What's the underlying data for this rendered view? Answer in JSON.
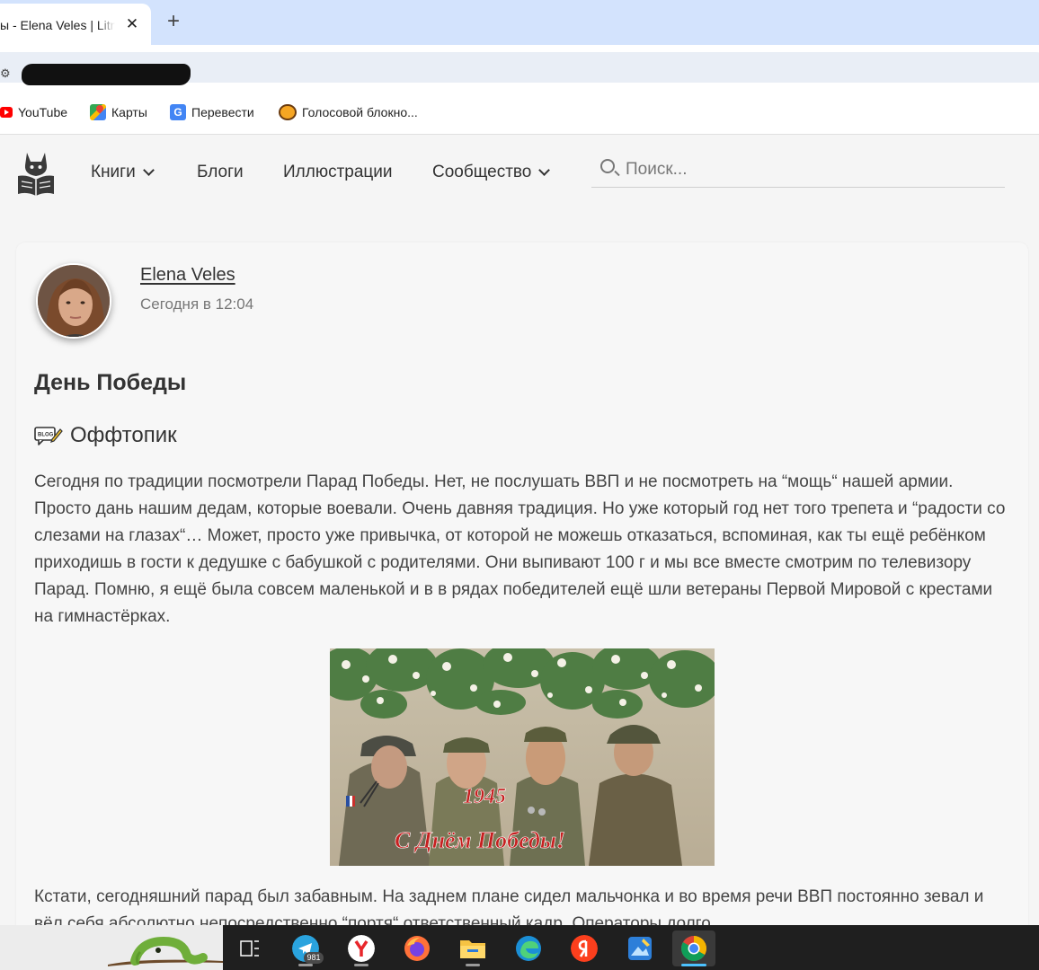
{
  "browser": {
    "tab_title": "ы - Elena Veles | Litnet",
    "tab_close": "✕",
    "new_tab": "+",
    "bookmarks": [
      {
        "label": "YouTube",
        "icon": "youtube-icon"
      },
      {
        "label": "Карты",
        "icon": "maps-icon"
      },
      {
        "label": "Перевести",
        "icon": "translate-icon"
      },
      {
        "label": "Голосовой блокно...",
        "icon": "voice-notepad-icon"
      }
    ]
  },
  "site": {
    "nav": {
      "books": "Книги",
      "blogs": "Блоги",
      "illustrations": "Иллюстрации",
      "community": "Сообщество"
    },
    "search_placeholder": "Поиск..."
  },
  "post": {
    "author": "Elena Veles",
    "time": "Сегодня в 12:04",
    "title": "День Победы",
    "category": "Оффтопик",
    "paragraph_1": "Сегодня по традиции посмотрели Парад Победы. Нет, не послушать ВВП и не посмотреть на “мощь“ нашей армии. Просто дань нашим дедам, которые воевали. Очень давняя традиция. Но уже который год нет того трепета и “радости со слезами на глазах“… Может, просто уже привычка, от которой не можешь отказаться, вспоминая, как ты ещё ребёнком приходишь в гости к дедушке с бабушкой с родителями. Они выпивают 100 г и мы все вместе смотрим по телевизору Парад. Помню, я ещё была совсем маленькой и в в рядах победителей ещё шли ветераны Первой Мировой с крестами на гимнастёрках.",
    "image": {
      "year": "1945",
      "greeting": "С Днём Победы!"
    },
    "paragraph_2": "Кстати, сегодняшний парад был забавным. На заднем плане сидел мальчонка и во время речи ВВП постоянно зевал и вёл себя абсолютно непосредственно “портя“ ответственный кадр. Операторы долго"
  },
  "taskbar": {
    "telegram_badge": "981",
    "apps": [
      "task-view",
      "telegram",
      "yandex-browser",
      "firefox",
      "file-explorer",
      "edge",
      "yandex",
      "paint",
      "chrome"
    ]
  },
  "colors": {
    "tab_strip": "#d3e3fd",
    "page_bg": "#f5f5f5",
    "text": "#333333",
    "taskbar": "#1f1f1f"
  }
}
